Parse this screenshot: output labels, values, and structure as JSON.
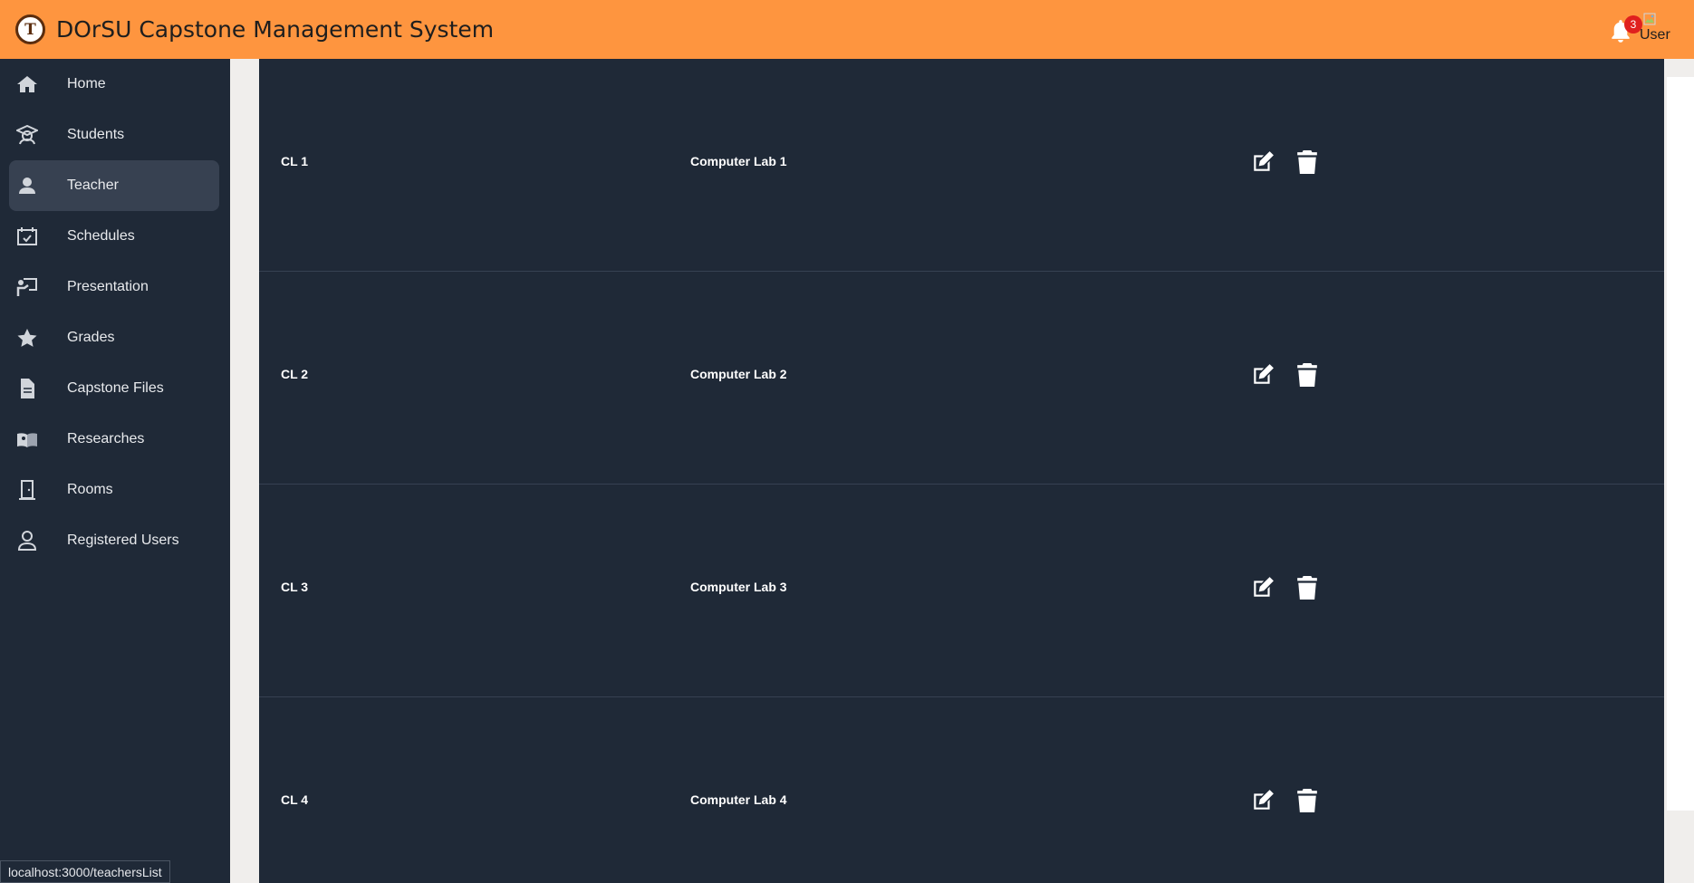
{
  "header": {
    "logo_letter": "T",
    "title": "DOrSU Capstone Management System",
    "notification_count": "3",
    "user_label": "User",
    "colors": {
      "bar": "#fe953f"
    }
  },
  "sidebar": {
    "items": [
      {
        "label": "Home",
        "icon": "home-icon"
      },
      {
        "label": "Students",
        "icon": "graduate-icon"
      },
      {
        "label": "Teacher",
        "icon": "person-icon",
        "active": true
      },
      {
        "label": "Schedules",
        "icon": "calendar-check-icon"
      },
      {
        "label": "Presentation",
        "icon": "presenter-icon"
      },
      {
        "label": "Grades",
        "icon": "star-icon"
      },
      {
        "label": "Capstone Files",
        "icon": "file-icon"
      },
      {
        "label": "Researches",
        "icon": "book-reader-icon"
      },
      {
        "label": "Rooms",
        "icon": "door-icon"
      },
      {
        "label": "Registered Users",
        "icon": "user-outline-icon"
      }
    ]
  },
  "rooms": {
    "rows": [
      {
        "code": "CL 1",
        "name": "Computer Lab 1"
      },
      {
        "code": "CL 2",
        "name": "Computer Lab 2"
      },
      {
        "code": "CL 3",
        "name": "Computer Lab 3"
      },
      {
        "code": "CL 4",
        "name": "Computer Lab 4"
      }
    ]
  },
  "statusbar": {
    "url": "localhost:3000/teachersList"
  }
}
